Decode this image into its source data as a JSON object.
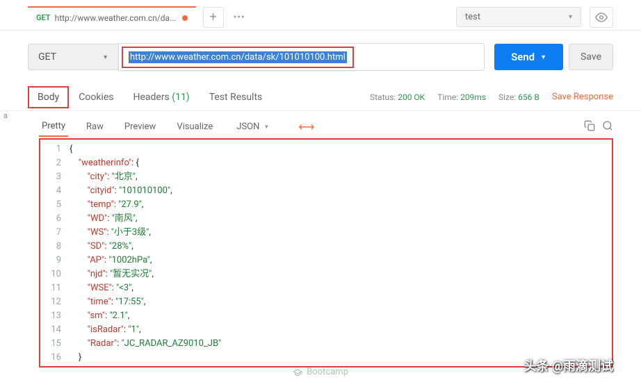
{
  "top": {
    "tab_method": "GET",
    "tab_title": "http://www.weather.com.cn/da...",
    "add": "+",
    "more": "•••",
    "env": "test"
  },
  "request": {
    "method": "GET",
    "url": "http://www.weather.com.cn/data/sk/101010100.html",
    "send": "Send",
    "save": "Save"
  },
  "left_label": "a",
  "resp_tabs": {
    "body": "Body",
    "cookies": "Cookies",
    "headers": "Headers",
    "headers_count": "(11)",
    "test_results": "Test Results"
  },
  "status": {
    "status_label": "Status:",
    "status_val": "200 OK",
    "time_label": "Time:",
    "time_val": "209ms",
    "size_label": "Size:",
    "size_val": "656 B",
    "save_response": "Save Response"
  },
  "view": {
    "pretty": "Pretty",
    "raw": "Raw",
    "preview": "Preview",
    "visualize": "Visualize",
    "format": "JSON"
  },
  "code": {
    "lines": [
      {
        "n": 1,
        "indent": 0,
        "type": "brace",
        "text": "{"
      },
      {
        "n": 2,
        "indent": 1,
        "type": "kv_open",
        "key": "weatherinfo",
        "after": ": {"
      },
      {
        "n": 3,
        "indent": 2,
        "type": "kv",
        "key": "city",
        "val": "北京",
        "comma": true
      },
      {
        "n": 4,
        "indent": 2,
        "type": "kv",
        "key": "cityid",
        "val": "101010100",
        "comma": true
      },
      {
        "n": 5,
        "indent": 2,
        "type": "kv",
        "key": "temp",
        "val": "27.9",
        "comma": true
      },
      {
        "n": 6,
        "indent": 2,
        "type": "kv",
        "key": "WD",
        "val": "南风",
        "comma": true
      },
      {
        "n": 7,
        "indent": 2,
        "type": "kv",
        "key": "WS",
        "val": "小于3级",
        "comma": true
      },
      {
        "n": 8,
        "indent": 2,
        "type": "kv",
        "key": "SD",
        "val": "28%",
        "comma": true
      },
      {
        "n": 9,
        "indent": 2,
        "type": "kv",
        "key": "AP",
        "val": "1002hPa",
        "comma": true
      },
      {
        "n": 10,
        "indent": 2,
        "type": "kv",
        "key": "njd",
        "val": "暂无实况",
        "comma": true
      },
      {
        "n": 11,
        "indent": 2,
        "type": "kv",
        "key": "WSE",
        "val": "<3",
        "comma": true
      },
      {
        "n": 12,
        "indent": 2,
        "type": "kv",
        "key": "time",
        "val": "17:55",
        "comma": true
      },
      {
        "n": 13,
        "indent": 2,
        "type": "kv",
        "key": "sm",
        "val": "2.1",
        "comma": true
      },
      {
        "n": 14,
        "indent": 2,
        "type": "kv",
        "key": "isRadar",
        "val": "1",
        "comma": true
      },
      {
        "n": 15,
        "indent": 2,
        "type": "kv",
        "key": "Radar",
        "val": "JC_RADAR_AZ9010_JB",
        "comma": false
      },
      {
        "n": 16,
        "indent": 1,
        "type": "brace",
        "text": "}"
      }
    ]
  },
  "bootcamp": "Bootcamp",
  "watermark": "头条 @雨滴测试"
}
